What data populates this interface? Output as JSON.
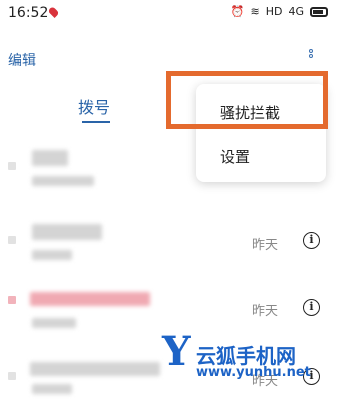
{
  "status_bar": {
    "time": "16:52",
    "network": "HD",
    "signal": "4G"
  },
  "header": {
    "edit_label": "编辑"
  },
  "tabs": {
    "dial_label": "拨号"
  },
  "popup_menu": {
    "items": [
      "骚扰拦截",
      "设置"
    ]
  },
  "call_log": {
    "rows": [
      {
        "date": ""
      },
      {
        "date": "昨天"
      },
      {
        "date": "昨天"
      },
      {
        "date": "昨天"
      }
    ],
    "info_icon_glyph": "i"
  },
  "watermark": {
    "letter": "Y",
    "name": "云狐手机网",
    "url": "www.yunhu.net"
  }
}
